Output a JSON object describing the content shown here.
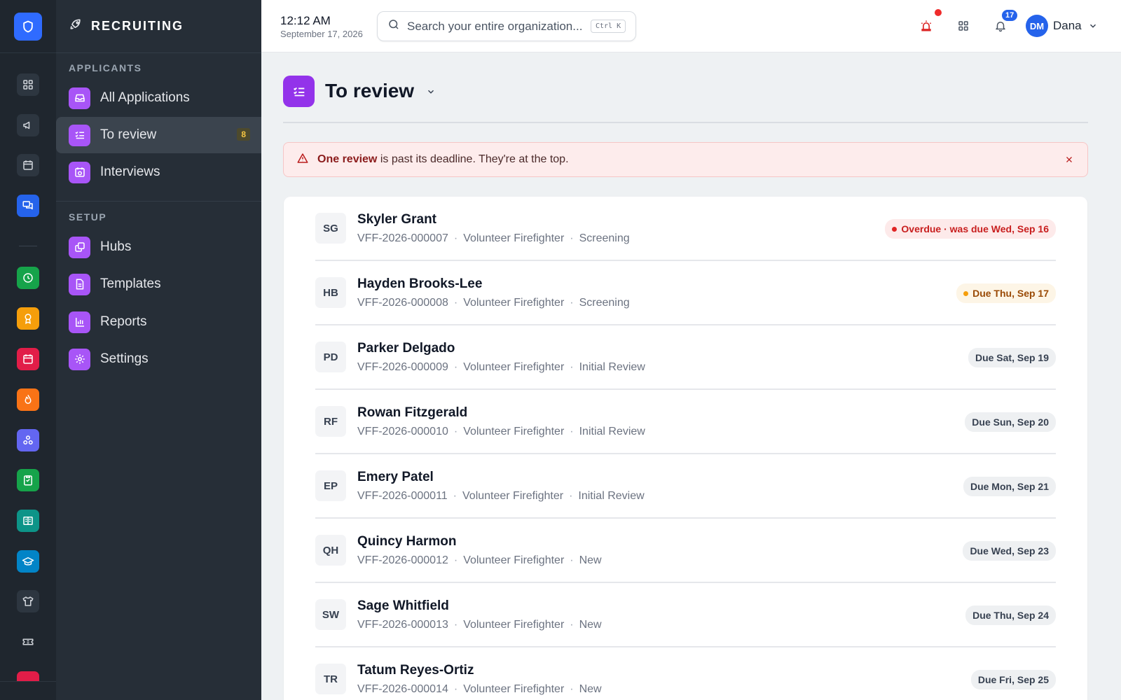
{
  "app": {
    "section_title": "RECRUITING"
  },
  "clock": {
    "time": "12:12 AM",
    "date": "September 17, 2026"
  },
  "search": {
    "placeholder": "Search your entire organization...",
    "shortcut": "Ctrl K"
  },
  "header": {
    "notification_count": "17",
    "user_initials": "DM",
    "user_name": "Dana"
  },
  "rail": {
    "items": [
      {
        "icon": "dashboard-icon",
        "color": "#2d3640"
      },
      {
        "icon": "megaphone-icon",
        "color": "#2d3640"
      },
      {
        "icon": "calendar-icon",
        "color": "#2d3640"
      },
      {
        "icon": "chat-icon",
        "color": "#2563eb"
      },
      {
        "icon": "clock-icon",
        "color": "#16a34a"
      },
      {
        "icon": "award-icon",
        "color": "#f59e0b"
      },
      {
        "icon": "calendar-event-icon",
        "color": "#e11d48"
      },
      {
        "icon": "flame-icon",
        "color": "#f97316"
      },
      {
        "icon": "hub-icon",
        "color": "#6366f1"
      },
      {
        "icon": "clipboard-check-icon",
        "color": "#16a34a"
      },
      {
        "icon": "book-icon",
        "color": "#0d9488"
      },
      {
        "icon": "graduation-cap-icon",
        "color": "#0284c7"
      },
      {
        "icon": "shirt-icon",
        "color": "#2d3640"
      },
      {
        "icon": "ticket-icon",
        "color": "#1f262e"
      }
    ]
  },
  "sidebar": {
    "applicants_heading": "APPLICANTS",
    "setup_heading": "SETUP",
    "items": [
      {
        "label": "All Applications",
        "icon": "inbox-icon"
      },
      {
        "label": "To review",
        "icon": "checklist-icon",
        "badge": "8"
      },
      {
        "label": "Interviews",
        "icon": "calendar-clock-icon"
      },
      {
        "label": "Hubs",
        "icon": "hubs-icon"
      },
      {
        "label": "Templates",
        "icon": "document-icon"
      },
      {
        "label": "Reports",
        "icon": "bar-chart-icon"
      },
      {
        "label": "Settings",
        "icon": "gear-icon"
      }
    ]
  },
  "main": {
    "title": "To review",
    "alert": {
      "strong": "One review",
      "text": " is past its deadline. They're at the top."
    },
    "applicants": [
      {
        "initials": "SG",
        "name": "Skyler Grant",
        "id": "VFF-2026-000007",
        "position": "Volunteer Firefighter",
        "stage": "Screening",
        "due": "Overdue · was due Wed, Sep 16",
        "status": "overdue"
      },
      {
        "initials": "HB",
        "name": "Hayden Brooks-Lee",
        "id": "VFF-2026-000008",
        "position": "Volunteer Firefighter",
        "stage": "Screening",
        "due": "Due Thu, Sep 17",
        "status": "today"
      },
      {
        "initials": "PD",
        "name": "Parker Delgado",
        "id": "VFF-2026-000009",
        "position": "Volunteer Firefighter",
        "stage": "Initial Review",
        "due": "Due Sat, Sep 19",
        "status": "normal"
      },
      {
        "initials": "RF",
        "name": "Rowan Fitzgerald",
        "id": "VFF-2026-000010",
        "position": "Volunteer Firefighter",
        "stage": "Initial Review",
        "due": "Due Sun, Sep 20",
        "status": "normal"
      },
      {
        "initials": "EP",
        "name": "Emery Patel",
        "id": "VFF-2026-000011",
        "position": "Volunteer Firefighter",
        "stage": "Initial Review",
        "due": "Due Mon, Sep 21",
        "status": "normal"
      },
      {
        "initials": "QH",
        "name": "Quincy Harmon",
        "id": "VFF-2026-000012",
        "position": "Volunteer Firefighter",
        "stage": "New",
        "due": "Due Wed, Sep 23",
        "status": "normal"
      },
      {
        "initials": "SW",
        "name": "Sage Whitfield",
        "id": "VFF-2026-000013",
        "position": "Volunteer Firefighter",
        "stage": "New",
        "due": "Due Thu, Sep 24",
        "status": "normal"
      },
      {
        "initials": "TR",
        "name": "Tatum Reyes-Ortiz",
        "id": "VFF-2026-000014",
        "position": "Volunteer Firefighter",
        "stage": "New",
        "due": "Due Fri, Sep 25",
        "status": "normal"
      }
    ]
  }
}
